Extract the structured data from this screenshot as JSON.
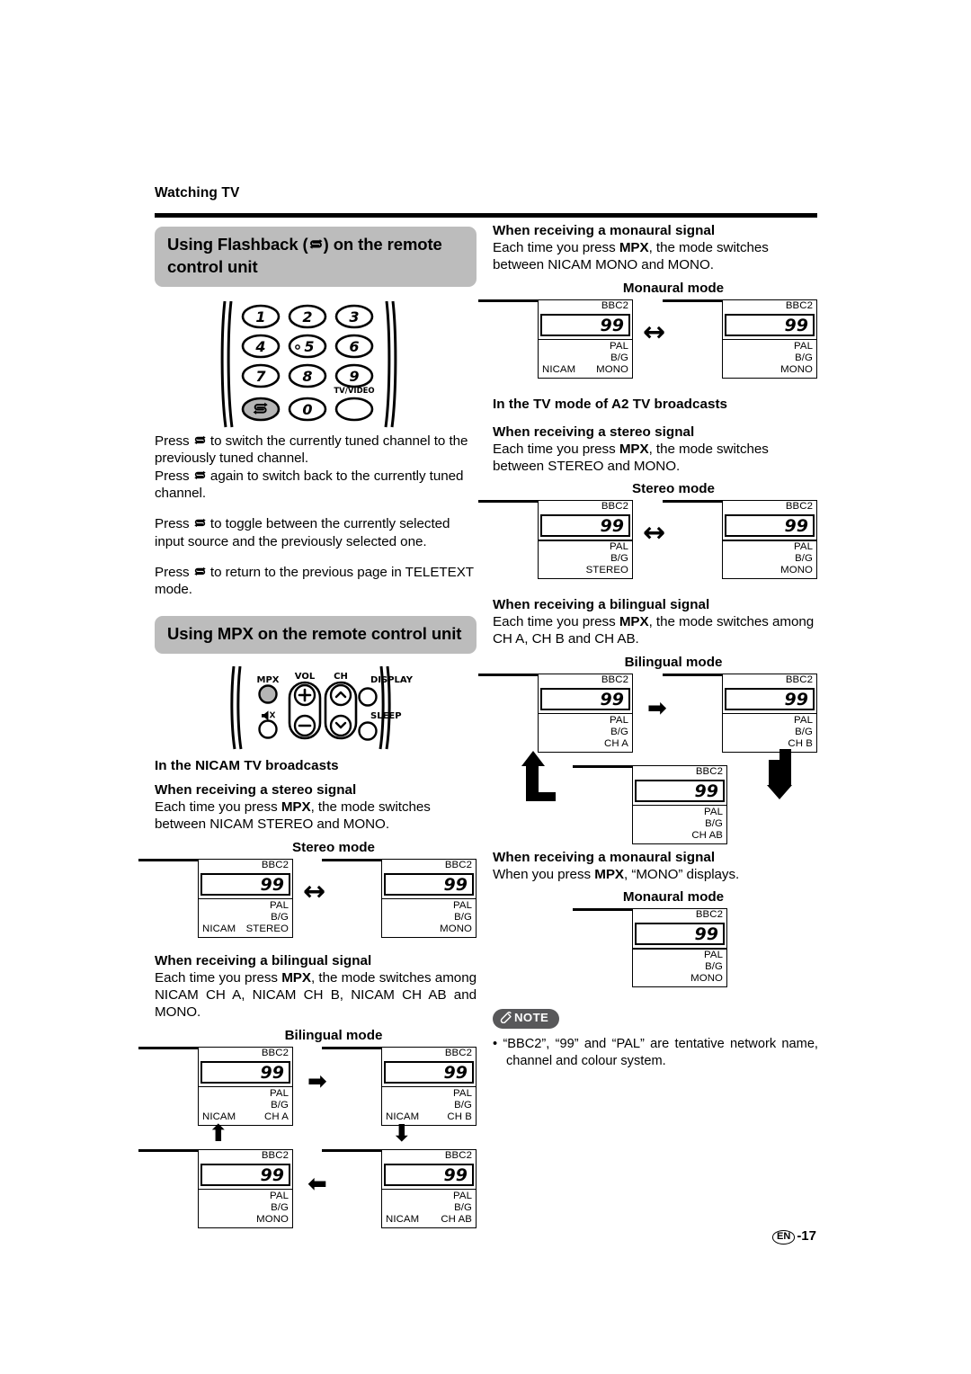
{
  "page": {
    "breadcrumb": "Watching TV",
    "footer_lang": "EN",
    "footer_page": "-17"
  },
  "left": {
    "section1": {
      "heading_a": "Using Flashback (",
      "heading_b": ") on the remote control unit",
      "keypad": {
        "keys": [
          "1",
          "2",
          "3",
          "4",
          "5",
          "6",
          "7",
          "8",
          "9"
        ],
        "zero": "0",
        "tv_video_label": "TV/VIDEO",
        "flashback_icon": "flashback-icon"
      },
      "p1": "Press  to switch the currently tuned channel to the previously tuned channel.",
      "p1_pre": "Press",
      "p1_post": "to switch the currently tuned channel to the previously tuned channel.",
      "p2_pre": "Press",
      "p2_post": "again to switch back to the currently tuned channel.",
      "p3_pre": "Press",
      "p3_post": "to toggle between the currently selected input source and the previously selected one.",
      "p4_pre": "Press",
      "p4_post": "to return to the previous page in TELETEXT mode."
    },
    "section2": {
      "heading": "Using MPX on the remote control unit",
      "remote_labels": {
        "mpx": "MPX",
        "vol": "VOL",
        "ch": "CH",
        "display": "DISPLAY",
        "sleep": "SLEEP",
        "plus": "+",
        "minus": "−",
        "mute_icon": "mute-icon"
      },
      "nicam_heading": "In the NICAM TV broadcasts",
      "stereo": {
        "sub": "When receiving a stereo signal",
        "text_pre": "Each time you press ",
        "text_bold": "MPX",
        "text_post": ", the mode switches between NICAM STEREO and MONO.",
        "caption": "Stereo mode",
        "box1": {
          "net": "BBC2",
          "chan": "99",
          "r1": "PAL",
          "r2": "B/G",
          "r3_left": "NICAM",
          "r3_right": "STEREO"
        },
        "box2": {
          "net": "BBC2",
          "chan": "99",
          "r1": "PAL",
          "r2": "B/G",
          "r3_left": "",
          "r3_right": "MONO"
        },
        "arrow": "↔"
      },
      "bilingual": {
        "sub": "When receiving a bilingual signal",
        "text_pre": "Each time you press ",
        "text_bold": "MPX",
        "text_post": ", the mode switches among NICAM CH A, NICAM CH B, NICAM CH AB and MONO.",
        "caption": "Bilingual mode",
        "box1": {
          "net": "BBC2",
          "chan": "99",
          "r1": "PAL",
          "r2": "B/G",
          "r3_left": "NICAM",
          "r3_right": "CH A"
        },
        "box2": {
          "net": "BBC2",
          "chan": "99",
          "r1": "PAL",
          "r2": "B/G",
          "r3_left": "NICAM",
          "r3_right": "CH B"
        },
        "box3": {
          "net": "BBC2",
          "chan": "99",
          "r1": "PAL",
          "r2": "B/G",
          "r3_left": "",
          "r3_right": "MONO"
        },
        "box4": {
          "net": "BBC2",
          "chan": "99",
          "r1": "PAL",
          "r2": "B/G",
          "r3_left": "NICAM",
          "r3_right": "CH AB"
        },
        "arrow_right": "➡",
        "arrow_down": "⬇",
        "arrow_left": "⬅",
        "arrow_up": "⬆"
      }
    }
  },
  "right": {
    "monaural_nicam": {
      "sub": "When receiving a monaural signal",
      "text_pre": "Each time you press ",
      "text_bold": "MPX",
      "text_post": ", the mode switches between NICAM MONO and MONO.",
      "caption": "Monaural mode",
      "box1": {
        "net": "BBC2",
        "chan": "99",
        "r1": "PAL",
        "r2": "B/G",
        "r3_left": "NICAM",
        "r3_right": "MONO"
      },
      "box2": {
        "net": "BBC2",
        "chan": "99",
        "r1": "PAL",
        "r2": "B/G",
        "r3_left": "",
        "r3_right": "MONO"
      },
      "arrow": "↔"
    },
    "a2_heading": "In the TV mode of A2 TV broadcasts",
    "stereo": {
      "sub": "When receiving a stereo signal",
      "text_pre": "Each time you press ",
      "text_bold": "MPX",
      "text_post": ", the mode switches between STEREO and MONO.",
      "caption": "Stereo mode",
      "box1": {
        "net": "BBC2",
        "chan": "99",
        "r1": "PAL",
        "r2": "B/G",
        "r3_left": "",
        "r3_right": "STEREO"
      },
      "box2": {
        "net": "BBC2",
        "chan": "99",
        "r1": "PAL",
        "r2": "B/G",
        "r3_left": "",
        "r3_right": "MONO"
      },
      "arrow": "↔"
    },
    "bilingual": {
      "sub": "When receiving a bilingual signal",
      "text_pre": "Each time you press ",
      "text_bold": "MPX",
      "text_post": ", the mode switches among CH A, CH B and CH AB.",
      "caption": "Bilingual mode",
      "box1": {
        "net": "BBC2",
        "chan": "99",
        "r1": "PAL",
        "r2": "B/G",
        "r3_left": "",
        "r3_right": "CH A"
      },
      "box2": {
        "net": "BBC2",
        "chan": "99",
        "r1": "PAL",
        "r2": "B/G",
        "r3_left": "",
        "r3_right": "CH B"
      },
      "box3": {
        "net": "BBC2",
        "chan": "99",
        "r1": "PAL",
        "r2": "B/G",
        "r3_left": "",
        "r3_right": "CH AB"
      },
      "arrow_right": "➡"
    },
    "monaural_a2": {
      "sub": "When receiving a monaural signal",
      "text_pre": "When you press ",
      "text_bold": "MPX",
      "text_post": ", “MONO” displays.",
      "caption": "Monaural mode",
      "box1": {
        "net": "BBC2",
        "chan": "99",
        "r1": "PAL",
        "r2": "B/G",
        "r3_left": "",
        "r3_right": "MONO"
      }
    },
    "note": {
      "badge": "NOTE",
      "bullet": "•",
      "text": "“BBC2”, “99” and “PAL” are tentative network name, channel and colour system."
    }
  },
  "colors": {
    "heading_bg": "#bcbcbc",
    "note_bg": "#58585a",
    "ink": "#000000",
    "paper": "#ffffff"
  }
}
